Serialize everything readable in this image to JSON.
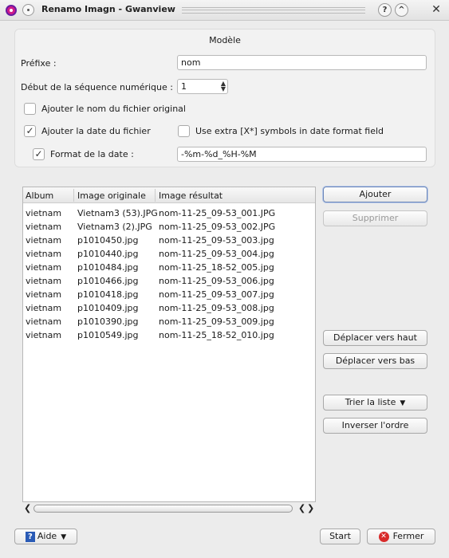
{
  "window": {
    "title": "Renamo Imagn - Gwanview",
    "help_button": "?",
    "shade_button": "^",
    "close_button": "✕"
  },
  "model": {
    "group_title": "Modèle",
    "prefix_label": "Préfixe :",
    "prefix_value": "nom",
    "sequence_label": "Début de la séquence numérique :",
    "sequence_value": "1",
    "add_original_name_label": "Ajouter le nom du fichier original",
    "add_original_name_checked": false,
    "add_file_date_label": "Ajouter la date du fichier",
    "add_file_date_checked": true,
    "extra_symbols_label": "Use extra [X*] symbols in date format field",
    "extra_symbols_checked": false,
    "date_format_label": "Format de la date :",
    "date_format_checked": true,
    "date_format_value": "-%m-%d_%H-%M"
  },
  "table": {
    "columns": [
      "Album",
      "Image originale",
      "Image résultat"
    ],
    "rows": [
      [
        "vietnam",
        "Vietnam3 (53).JPG",
        "nom-11-25_09-53_001.JPG"
      ],
      [
        "vietnam",
        "Vietnam3 (2).JPG",
        "nom-11-25_09-53_002.JPG"
      ],
      [
        "vietnam",
        "p1010450.jpg",
        "nom-11-25_09-53_003.jpg"
      ],
      [
        "vietnam",
        "p1010440.jpg",
        "nom-11-25_09-53_004.jpg"
      ],
      [
        "vietnam",
        "p1010484.jpg",
        "nom-11-25_18-52_005.jpg"
      ],
      [
        "vietnam",
        "p1010466.jpg",
        "nom-11-25_09-53_006.jpg"
      ],
      [
        "vietnam",
        "p1010418.jpg",
        "nom-11-25_09-53_007.jpg"
      ],
      [
        "vietnam",
        "p1010409.jpg",
        "nom-11-25_09-53_008.jpg"
      ],
      [
        "vietnam",
        "p1010390.jpg",
        "nom-11-25_09-53_009.jpg"
      ],
      [
        "vietnam",
        "p1010549.jpg",
        "nom-11-25_18-52_010.jpg"
      ]
    ]
  },
  "actions": {
    "add": "Ajouter",
    "remove": "Supprimer",
    "move_up": "Déplacer vers haut",
    "move_down": "Déplacer vers bas",
    "sort": "Trier la liste",
    "reverse": "Inverser l'ordre"
  },
  "footer": {
    "help": "Aide",
    "start": "Start",
    "close": "Fermer"
  }
}
